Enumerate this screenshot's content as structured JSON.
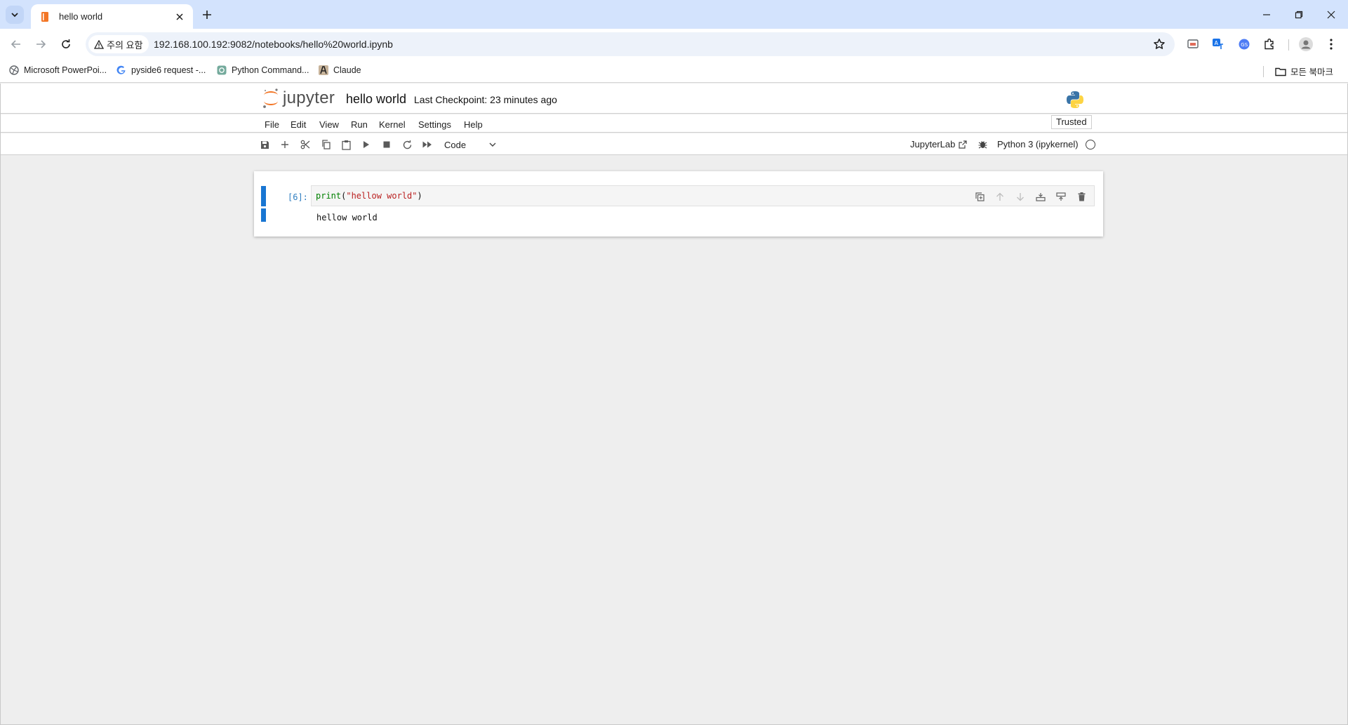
{
  "browser": {
    "tab": {
      "title": "hello world"
    },
    "address": {
      "security_label": "주의 요함",
      "url": "192.168.100.192:9082/notebooks/hello%20world.ipynb"
    },
    "bookmarks": [
      {
        "label": "Microsoft PowerPoi..."
      },
      {
        "label": "pyside6 request -..."
      },
      {
        "label": "Python Command..."
      },
      {
        "label": "Claude"
      }
    ],
    "all_bookmarks_label": "모든 북마크"
  },
  "jupyter": {
    "logo_text": "jupyter",
    "notebook_title": "hello world",
    "checkpoint": "Last Checkpoint: 23 minutes ago",
    "menu": [
      "File",
      "Edit",
      "View",
      "Run",
      "Kernel",
      "Settings",
      "Help"
    ],
    "trusted_label": "Trusted",
    "cell_type": "Code",
    "jupyterlab_link": "JupyterLab",
    "kernel_name": "Python 3 (ipykernel)",
    "cells": [
      {
        "prompt": "[6]:",
        "code_fn": "print",
        "code_open": "(",
        "code_string": "\"hellow world\"",
        "code_close": ")",
        "output": "hellow world"
      }
    ]
  },
  "colors": {
    "tabstrip": "#d3e3fd",
    "cell_selected_bar": "#1976d2",
    "prompt": "#307fc1"
  }
}
